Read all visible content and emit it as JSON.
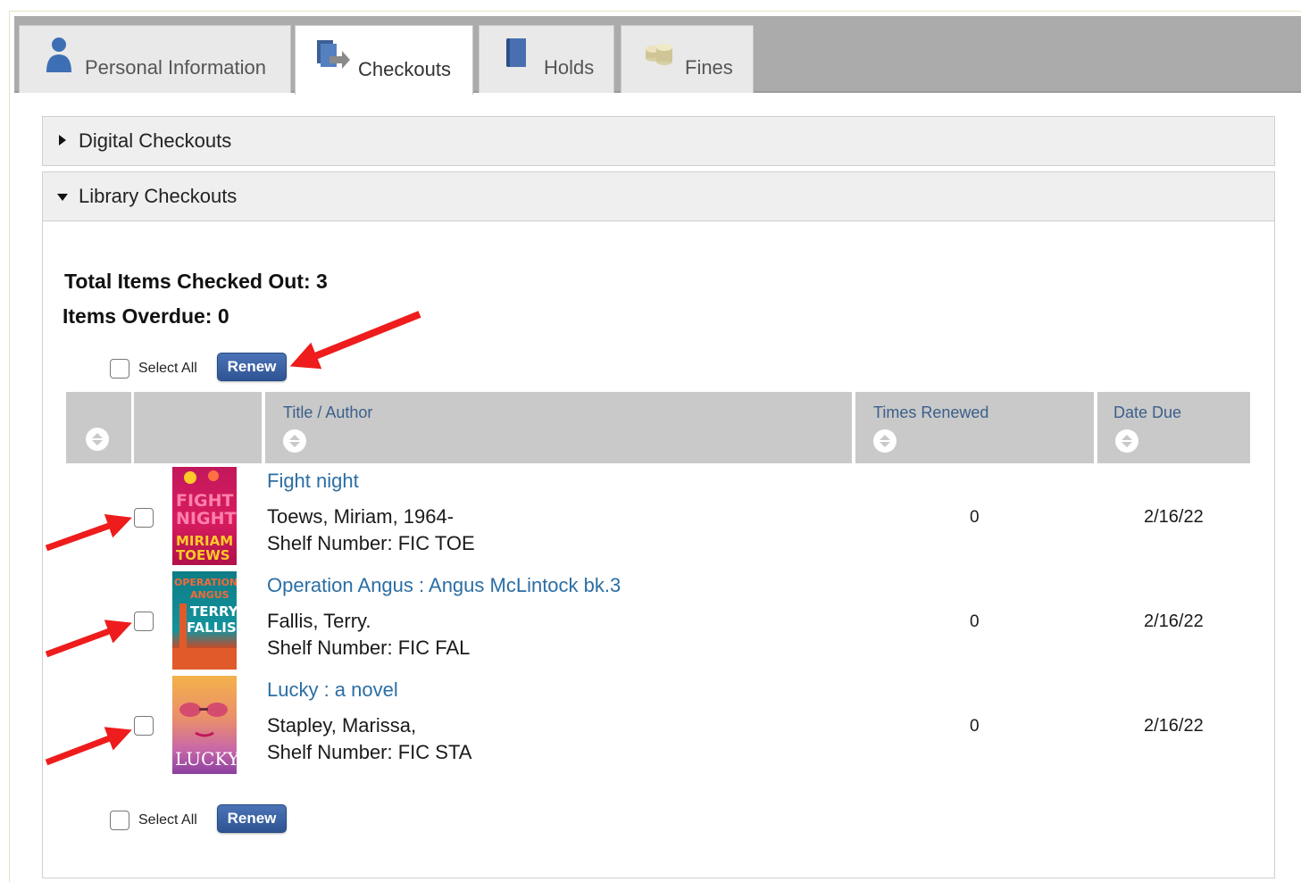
{
  "tabs": [
    {
      "label": "Personal Information",
      "icon": "person-icon"
    },
    {
      "label": "Checkouts",
      "icon": "checkout-icon"
    },
    {
      "label": "Holds",
      "icon": "book-icon"
    },
    {
      "label": "Fines",
      "icon": "coins-icon"
    }
  ],
  "sections": {
    "digital": "Digital Checkouts",
    "library": "Library Checkouts"
  },
  "summary": {
    "total": "Total Items Checked Out: 3",
    "overdue": "Items Overdue: 0"
  },
  "controls": {
    "select_all": "Select All",
    "renew": "Renew"
  },
  "table": {
    "headers": {
      "title_author": "Title / Author",
      "times_renewed": "Times Renewed",
      "date_due": "Date Due"
    },
    "rows": [
      {
        "title": "Fight night",
        "author": "Toews, Miriam, 1964-",
        "shelf": "Shelf Number: FIC TOE",
        "times_renewed": "0",
        "date_due": "2/16/22",
        "cover_text": "FIGHT NIGHT MIRIAM TOEWS"
      },
      {
        "title": "Operation Angus : Angus McLintock bk.3",
        "author": "Fallis, Terry.",
        "shelf": "Shelf Number: FIC FAL",
        "times_renewed": "0",
        "date_due": "2/16/22",
        "cover_text": "OPERATION ANGUS TERRY FALLIS"
      },
      {
        "title": "Lucky : a novel",
        "author": "Stapley, Marissa,",
        "shelf": "Shelf Number: FIC STA",
        "times_renewed": "0",
        "date_due": "2/16/22",
        "cover_text": "LUCKY"
      }
    ]
  },
  "colors": {
    "tabbar": "#ababab",
    "renew_button": "#3a63a6",
    "link": "#2b6ea5",
    "header_bg": "#c9c9c9",
    "annotation_arrow": "#ee1c1c"
  }
}
